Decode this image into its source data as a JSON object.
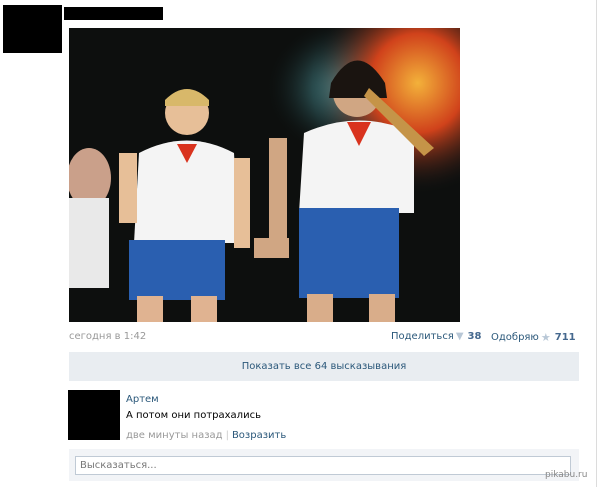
{
  "post": {
    "date": "сегодня в 1:42",
    "photo_alt": "Concert photo"
  },
  "actions": {
    "share_label": "Поделиться",
    "share_count": "38",
    "like_label": "Одобряю",
    "like_count": "711"
  },
  "comments": {
    "show_all_label": "Показать все 64 высказывания",
    "items": [
      {
        "author": "Артем",
        "text": "А потом они потрахались",
        "time": "две минуты назад",
        "reply_label": "Возразить"
      }
    ]
  },
  "reply": {
    "placeholder": "Высказаться..."
  },
  "watermark": "pikabu.ru",
  "colors": {
    "link": "#2b587a",
    "count": "#45688e",
    "muted": "#999999",
    "panel": "#e9edf1"
  }
}
